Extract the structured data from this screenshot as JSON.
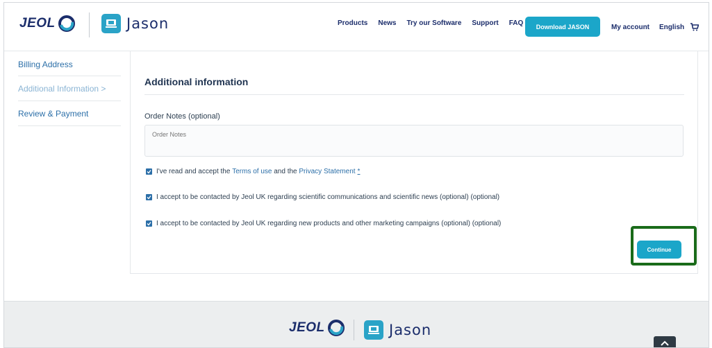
{
  "header": {
    "jeol_logo": "JEOL",
    "jason_logo": "Jason",
    "nav": [
      "Products",
      "News",
      "Try our Software",
      "Support",
      "FAQ"
    ],
    "download_label": "Download JASON",
    "account_label": "My account",
    "language_label": "English",
    "cart_icon": "cart-icon"
  },
  "sidebar": {
    "items": [
      {
        "label": "Billing Address"
      },
      {
        "label": "Additional Information >"
      },
      {
        "label": "Review & Payment"
      }
    ]
  },
  "main": {
    "title": "Additional information",
    "notes_label": "Order Notes (optional)",
    "notes_placeholder": "Order Notes",
    "terms": {
      "prefix": "I've read and accept the ",
      "terms_link": "Terms of use",
      "middle": " and the ",
      "privacy_link": "Privacy Statement",
      "required": "*"
    },
    "consent_scientific": "I accept to be contacted by Jeol UK regarding scientific communications and scientific news (optional) (optional)",
    "consent_marketing": "I accept to be contacted by Jeol UK regarding new products and other marketing campaigns (optional) (optional)",
    "continue_label": "Continue"
  },
  "footer": {
    "jeol_logo": "JEOL",
    "jason_logo": "Jason"
  },
  "colors": {
    "accent": "#1ba6c9",
    "brand_navy": "#1b2d6b",
    "link": "#2c6fa8",
    "highlight_border": "#1a6b1a"
  }
}
